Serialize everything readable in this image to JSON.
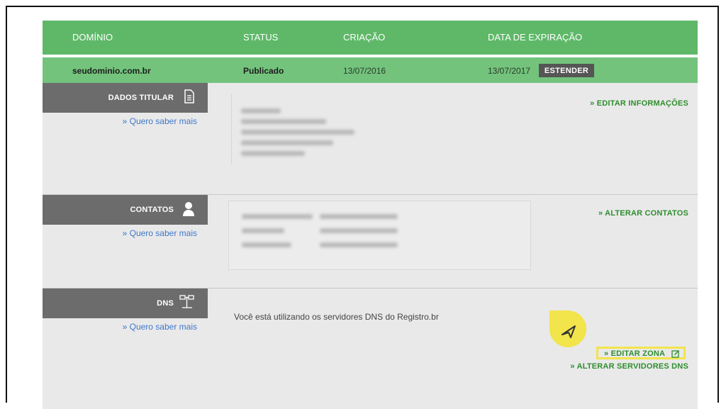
{
  "table_header": {
    "domain": "DOMÍNIO",
    "status": "STATUS",
    "created": "CRIAÇÃO",
    "expiration": "DATA DE EXPIRAÇÃO"
  },
  "domain_row": {
    "domain": "seudominio.com.br",
    "status": "Publicado",
    "created": "13/07/2016",
    "expiration": "13/07/2017",
    "extend_label": "ESTENDER"
  },
  "sections": {
    "titular": {
      "label": "DADOS TITULAR",
      "icon": "document-icon",
      "more_link": "» Quero saber mais",
      "action": "» EDITAR INFORMAÇÕES"
    },
    "contatos": {
      "label": "CONTATOS",
      "icon": "user-icon",
      "more_link": "» Quero saber mais",
      "action": "» ALTERAR CONTATOS"
    },
    "dns": {
      "label": "DNS",
      "icon": "network-icon",
      "more_link": "» Quero saber mais",
      "info": "Você está utilizando os servidores DNS do Registro.br",
      "edit_zone": "» EDITAR ZONA",
      "edit_zone_icon": "edit-icon",
      "change_servers": "» ALTERAR SERVIDORES DNS"
    }
  },
  "colors": {
    "header_green": "#5eb868",
    "row_green": "#73c37c",
    "label_gray": "#6c6c6c",
    "section_bg": "#e9e9e9",
    "link_blue": "#3f78c8",
    "action_green": "#2e8e2e",
    "highlight_yellow": "#f2e44b"
  }
}
